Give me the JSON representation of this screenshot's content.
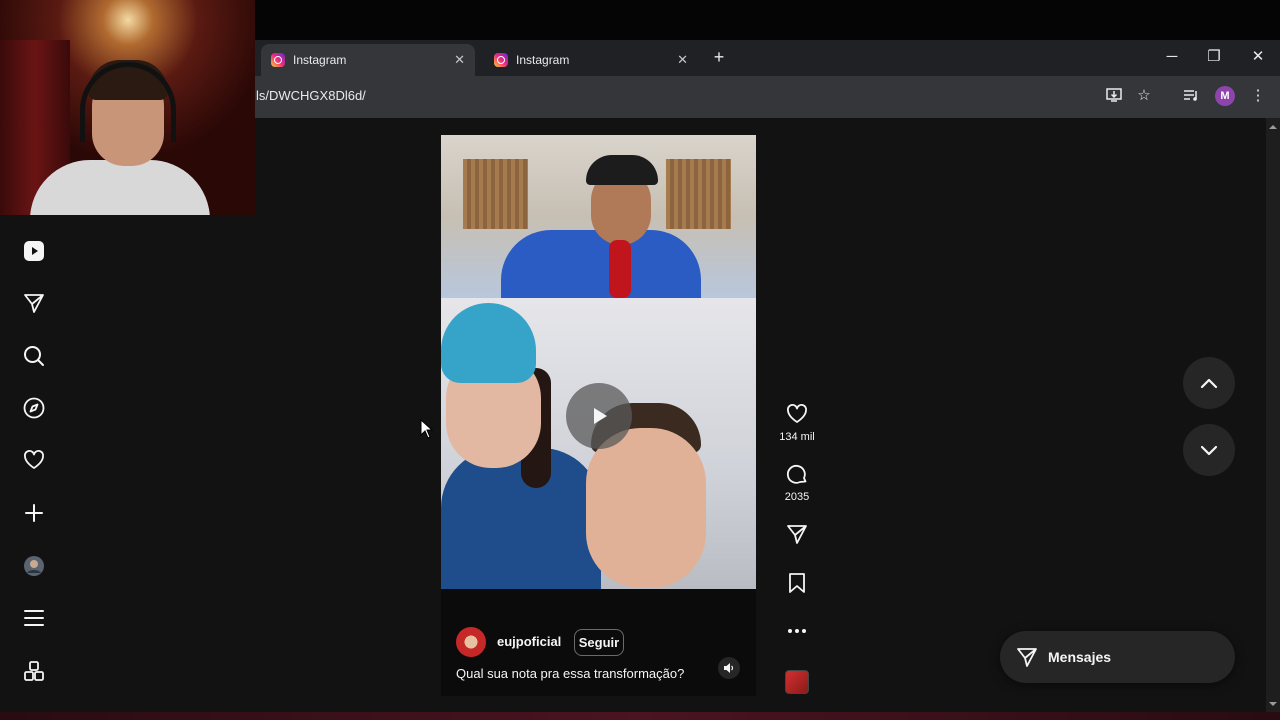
{
  "browser": {
    "tabs": [
      {
        "label": "Instagram",
        "active": true
      },
      {
        "label": "Instagram",
        "active": false
      }
    ],
    "new_tab_icon": "plus-icon",
    "url": "ls/DWCHGX8Dl6d/",
    "profile_initial": "M",
    "window_controls": [
      "minimize-icon",
      "restore-icon",
      "close-icon"
    ]
  },
  "sidebar": {
    "items": [
      {
        "name": "reels",
        "icon": "reels-icon"
      },
      {
        "name": "messages",
        "icon": "send-icon"
      },
      {
        "name": "search",
        "icon": "search-icon"
      },
      {
        "name": "explore",
        "icon": "compass-icon"
      },
      {
        "name": "notifications",
        "icon": "heart-icon"
      },
      {
        "name": "create",
        "icon": "plus-icon"
      },
      {
        "name": "profile",
        "icon": "avatar"
      },
      {
        "name": "more",
        "icon": "menu-icon"
      },
      {
        "name": "also-from-meta",
        "icon": "apps-icon"
      }
    ]
  },
  "post": {
    "username": "eujpoficial",
    "follow_label": "Seguir",
    "caption": "Qual sua nota pra essa transformação?",
    "likes": "134 mil",
    "comments": "2035"
  },
  "messages_button": {
    "label": "Mensajes"
  },
  "colors": {
    "page_bg": "#121212",
    "chrome_tab_bar": "#202124",
    "chrome_toolbar": "#35363a",
    "button_bg": "#262626",
    "text": "#f5f5f5"
  }
}
